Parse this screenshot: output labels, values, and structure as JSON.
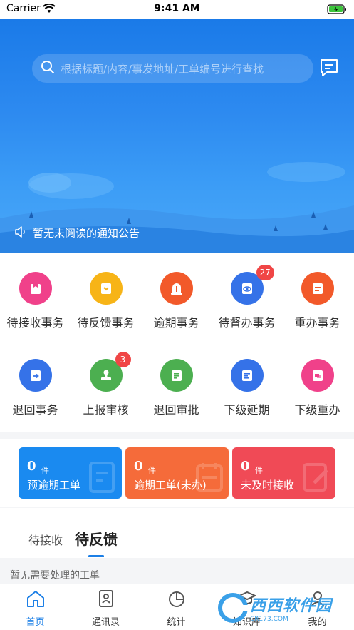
{
  "status_bar": {
    "carrier": "Carrier",
    "time": "9:41 AM"
  },
  "search": {
    "placeholder": "根据标题/内容/事发地址/工单编号进行查找"
  },
  "notice": {
    "text": "暂无未阅读的通知公告"
  },
  "grid": {
    "row1": [
      {
        "label": "待接收事务",
        "color": "#f0418a",
        "icon": "inbox-icon"
      },
      {
        "label": "待反馈事务",
        "color": "#f7b417",
        "icon": "feedback-icon"
      },
      {
        "label": "逾期事务",
        "color": "#f2592a",
        "icon": "alert-icon"
      },
      {
        "label": "待督办事务",
        "color": "#3572e8",
        "icon": "supervise-icon",
        "badge": "27"
      },
      {
        "label": "重办事务",
        "color": "#f2592a",
        "icon": "redo-icon"
      }
    ],
    "row2": [
      {
        "label": "退回事务",
        "color": "#3572e8",
        "icon": "return-icon"
      },
      {
        "label": "上报审核",
        "color": "#4caf50",
        "icon": "report-review-icon",
        "badge": "3"
      },
      {
        "label": "退回审批",
        "color": "#4caf50",
        "icon": "return-approval-icon"
      },
      {
        "label": "下级延期",
        "color": "#3572e8",
        "icon": "extension-icon"
      },
      {
        "label": "下级重办",
        "color": "#f0418a",
        "icon": "sub-redo-icon"
      }
    ]
  },
  "stats": [
    {
      "count": "0",
      "unit": "件",
      "title": "预逾期工单",
      "color": "#1a8af0"
    },
    {
      "count": "0",
      "unit": "件",
      "title": "逾期工单(未办)",
      "color": "#f56b3a"
    },
    {
      "count": "0",
      "unit": "件",
      "title": "未及时接收",
      "color": "#f04a56"
    }
  ],
  "tabs": {
    "pending_receive": "待接收",
    "pending_feedback": "待反馈",
    "active": "pending_feedback"
  },
  "empty_text": "暂无需要处理的工单",
  "tabbar": [
    {
      "label": "首页",
      "icon": "home-icon",
      "active": true
    },
    {
      "label": "通讯录",
      "icon": "contacts-icon"
    },
    {
      "label": "统计",
      "icon": "chart-icon"
    },
    {
      "label": "知识库",
      "icon": "knowledge-icon"
    },
    {
      "label": "我的",
      "icon": "user-icon"
    }
  ],
  "watermark": {
    "title": "西西软件园",
    "subtitle": "CR173.COM"
  },
  "colors": {
    "brand": "#1c7fe6",
    "hero": "#2d8af0"
  }
}
